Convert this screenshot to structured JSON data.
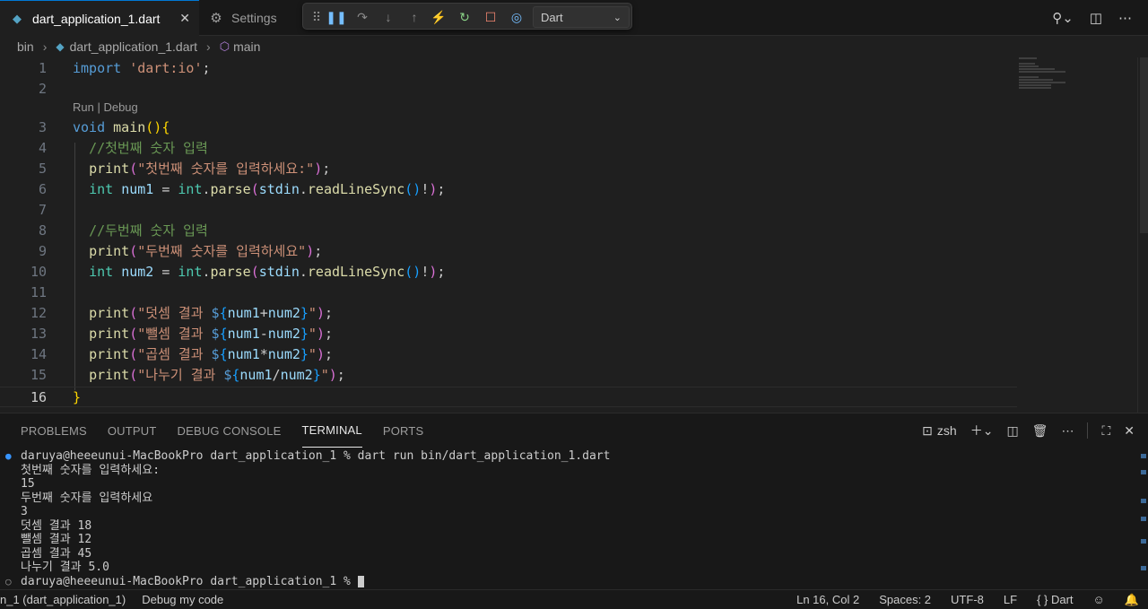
{
  "tabs": [
    {
      "label": "dart_application_1.dart",
      "icon": "dart-icon",
      "active": true
    },
    {
      "label": "Settings",
      "icon": "settings-icon",
      "active": false
    }
  ],
  "debug_toolbar": {
    "config": "Dart"
  },
  "breadcrumb": {
    "folder": "bin",
    "file": "dart_application_1.dart",
    "symbol": "main"
  },
  "codelens": "Run | Debug",
  "editor": {
    "current_line": 16,
    "line_numbers": [
      "1",
      "2",
      "3",
      "4",
      "5",
      "6",
      "7",
      "8",
      "9",
      "10",
      "11",
      "12",
      "13",
      "14",
      "15",
      "16"
    ]
  },
  "panel": {
    "tabs": [
      "PROBLEMS",
      "OUTPUT",
      "DEBUG CONSOLE",
      "TERMINAL",
      "PORTS"
    ],
    "active_tab": "TERMINAL",
    "shell": "zsh"
  },
  "terminal": {
    "lines": [
      "daruya@heeeunui-MacBookPro dart_application_1 % dart run bin/dart_application_1.dart",
      "첫번째 숫자를 입력하세요:",
      "15",
      "두번째 숫자를 입력하세요",
      "3",
      "덧셈 결과 18",
      "뺄셈 결과 12",
      "곱셈 결과 45",
      "나누기 결과 5.0"
    ],
    "prompt": "daruya@heeeunui-MacBookPro dart_application_1 % "
  },
  "statusbar": {
    "launch": "n_1 (dart_application_1)",
    "debug": "Debug my code",
    "position": "Ln 16, Col 2",
    "spaces": "Spaces: 2",
    "encoding": "UTF-8",
    "eol": "LF",
    "language": "{ } Dart"
  },
  "colors": {
    "accent": "#0078d4",
    "keyword": "#569cd6",
    "string": "#ce9178",
    "comment": "#6a9955"
  }
}
